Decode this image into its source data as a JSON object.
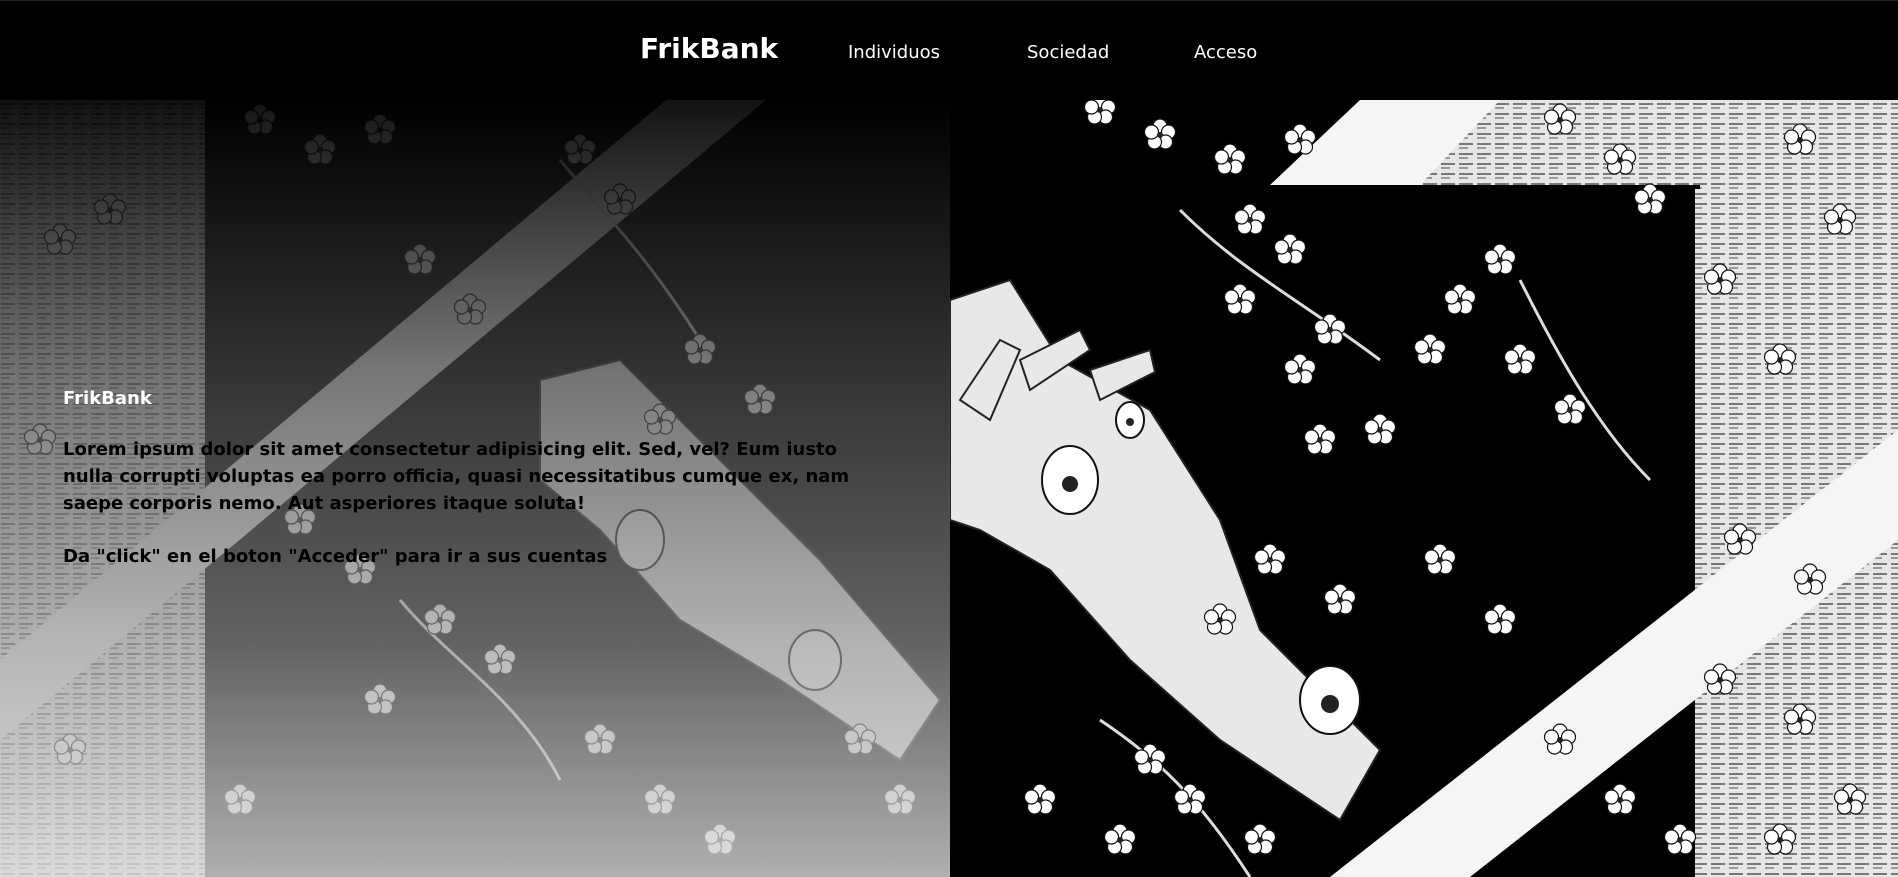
{
  "navbar": {
    "brand": "FrikBank",
    "links": [
      "Individuos",
      "Sociedad",
      "Acceso"
    ]
  },
  "hero": {
    "title": "FrikBank",
    "description": "Lorem ipsum dolor sit amet consectetur adipisicing elit. Sed, vel? Eum iusto nulla corrupti voluptas ea porro officia, quasi necessitatibus cumque ex, nam saepe corporis nemo. Aut asperiores itaque soluta!",
    "cta_text": "Da \"click\" en el boton \"Acceder\" para ir a sus cuentas"
  },
  "colors": {
    "navbar_bg": "#000000",
    "nav_text": "#ffffff",
    "body_text": "#000000",
    "art_light": "#ffffff",
    "art_dark": "#000000"
  }
}
